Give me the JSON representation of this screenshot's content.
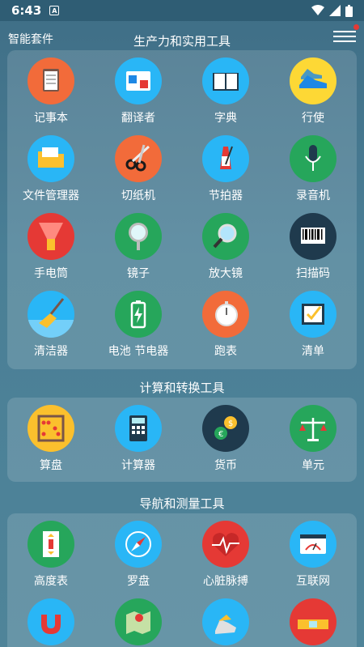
{
  "status": {
    "time": "6:43",
    "badge": "A"
  },
  "app": {
    "name": "智能套件"
  },
  "sections": [
    {
      "title": "生产力和实用工具",
      "items": [
        {
          "label": "记事本",
          "icon": "notepad-icon",
          "color": "#f26b3a"
        },
        {
          "label": "翻译者",
          "icon": "translate-icon",
          "color": "#29b6f6"
        },
        {
          "label": "字典",
          "icon": "dictionary-icon",
          "color": "#29b6f6"
        },
        {
          "label": "行使",
          "icon": "sneaker-icon",
          "color": "#fdd835"
        },
        {
          "label": "文件管理器",
          "icon": "folder-icon",
          "color": "#29b6f6"
        },
        {
          "label": "切纸机",
          "icon": "scissors-icon",
          "color": "#f26b3a"
        },
        {
          "label": "节拍器",
          "icon": "metronome-icon",
          "color": "#29b6f6"
        },
        {
          "label": "录音机",
          "icon": "microphone-icon",
          "color": "#26a65b"
        },
        {
          "label": "手电筒",
          "icon": "flashlight-icon",
          "color": "#e53935"
        },
        {
          "label": "镜子",
          "icon": "mirror-icon",
          "color": "#26a65b"
        },
        {
          "label": "放大镜",
          "icon": "magnifier-icon",
          "color": "#26a65b"
        },
        {
          "label": "扫描码",
          "icon": "barcode-icon",
          "color": "#1f3a4d"
        },
        {
          "label": "清洁器",
          "icon": "broom-icon",
          "color": "#29b6f6"
        },
        {
          "label": "电池 节电器",
          "icon": "battery-icon",
          "color": "#26a65b"
        },
        {
          "label": "跑表",
          "icon": "stopwatch-icon",
          "color": "#f26b3a"
        },
        {
          "label": "清单",
          "icon": "checklist-icon",
          "color": "#29b6f6"
        }
      ]
    },
    {
      "title": "计算和转换工具",
      "items": [
        {
          "label": "算盘",
          "icon": "abacus-icon",
          "color": "#fbc02d"
        },
        {
          "label": "计算器",
          "icon": "calculator-icon",
          "color": "#29b6f6"
        },
        {
          "label": "货币",
          "icon": "currency-icon",
          "color": "#1f3a4d"
        },
        {
          "label": "单元",
          "icon": "scale-icon",
          "color": "#26a65b"
        }
      ]
    },
    {
      "title": "导航和测量工具",
      "items": [
        {
          "label": "高度表",
          "icon": "elevator-icon",
          "color": "#26a65b"
        },
        {
          "label": "罗盘",
          "icon": "compass-icon",
          "color": "#29b6f6"
        },
        {
          "label": "心脏脉搏",
          "icon": "heart-pulse-icon",
          "color": "#e53935"
        },
        {
          "label": "互联网",
          "icon": "speedometer-icon",
          "color": "#29b6f6"
        },
        {
          "label": "",
          "icon": "magnet-icon",
          "color": "#29b6f6"
        },
        {
          "label": "",
          "icon": "map-icon",
          "color": "#26a65b"
        },
        {
          "label": "",
          "icon": "pedometer-icon",
          "color": "#29b6f6"
        },
        {
          "label": "",
          "icon": "level-icon",
          "color": "#e53935"
        }
      ]
    }
  ]
}
